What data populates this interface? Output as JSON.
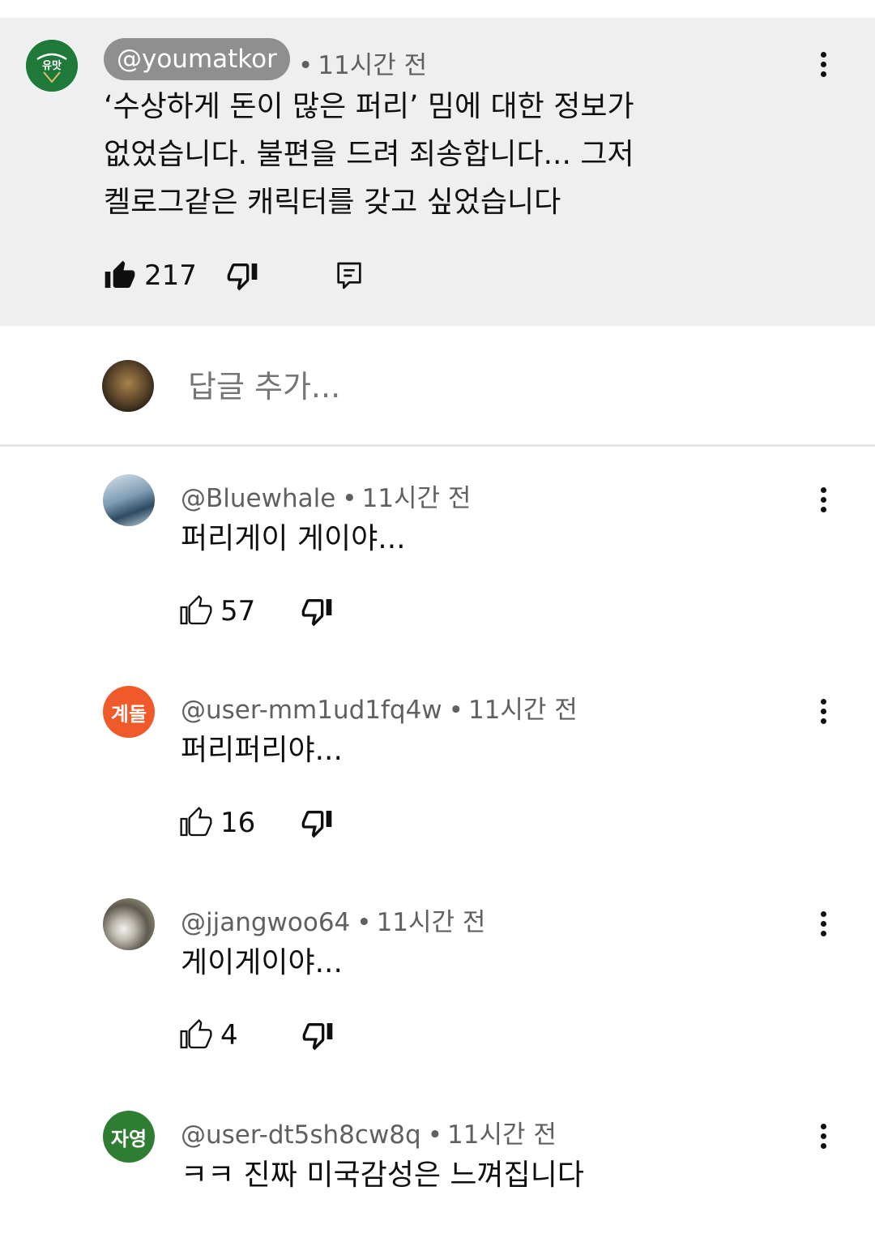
{
  "pinned_comment": {
    "author": "@youmatkor",
    "time": "11시간 전",
    "separator": "•",
    "avatar_label": "유맛",
    "text_lines": [
      "‘수상하게 돈이 많은 퍼리’ 밈에 대한 정보가",
      "없었습니다. 불편을 드려 죄송합니다... 그저",
      "켈로그같은 캐릭터를 갖고 싶었습니다"
    ],
    "likes": "217"
  },
  "reply_box": {
    "placeholder": "답글 추가..."
  },
  "replies": [
    {
      "author": "@Bluewhale",
      "time": "11시간 전",
      "text": "퍼리게이 게이야...",
      "likes": "57",
      "avatar_label": "",
      "avatar_color": "#5d7d98"
    },
    {
      "author": "@user-mm1ud1fq4w",
      "time": "11시간 전",
      "text": "퍼리퍼리야...",
      "likes": "16",
      "avatar_label": "계돌",
      "avatar_color": "#f0592a"
    },
    {
      "author": "@jjangwoo64",
      "time": "11시간 전",
      "text": "게이게이야...",
      "likes": "4",
      "avatar_label": "",
      "avatar_color": "#7a7568"
    },
    {
      "author": "@user-dt5sh8cw8q",
      "time": "11시간 전",
      "text": "ㅋㅋ 진짜 미국감성은 느껴집니다",
      "likes": "",
      "avatar_label": "자영",
      "avatar_color": "#2f7d32"
    }
  ],
  "colors": {
    "pinned_bg": "#efefef",
    "author_pill_bg": "#8f8f8f",
    "secondary_text": "#606060",
    "primary_text": "#0f0f0f"
  },
  "icons": {
    "like_filled": "thumbs-up-filled-icon",
    "like": "thumbs-up-icon",
    "dislike": "thumbs-down-icon",
    "reply": "comment-reply-icon",
    "more": "more-vertical-icon"
  }
}
